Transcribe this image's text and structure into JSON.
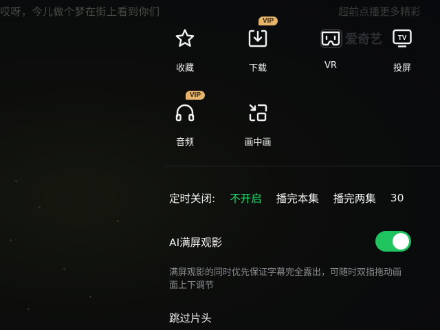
{
  "video": {
    "subtitle_ghost": "哎呀，今儿做个梦在街上看到你们",
    "top_right_ghost": "超前点播更多精彩",
    "watermark": "爱奇艺"
  },
  "menu": {
    "icons": [
      {
        "label": "收藏",
        "icon": "star-icon",
        "vip": false
      },
      {
        "label": "下载",
        "icon": "download-icon",
        "vip": true
      },
      {
        "label": "VR",
        "icon": "vr-headset-icon",
        "vip": false
      },
      {
        "label": "投屏",
        "icon": "tv-cast-icon",
        "vip": false
      },
      {
        "label": "音频",
        "icon": "headphones-icon",
        "vip": true
      },
      {
        "label": "画中画",
        "icon": "picture-in-picture-icon",
        "vip": false
      }
    ],
    "vip_label": "VIP"
  },
  "timer": {
    "title": "定时关闭:",
    "options": [
      "不开启",
      "播完本集",
      "播完两集",
      "30"
    ],
    "selected": "不开启",
    "active_color": "#1fd66b"
  },
  "ai_fullscreen": {
    "title": "AI满屏观影",
    "enabled": true,
    "toggle_color": "#1fc45f",
    "description": "满屏观影的同时优先保证字幕完全露出，可随时双指拖动画面上下调节"
  },
  "skip_intro": {
    "title": "跳过片头"
  }
}
